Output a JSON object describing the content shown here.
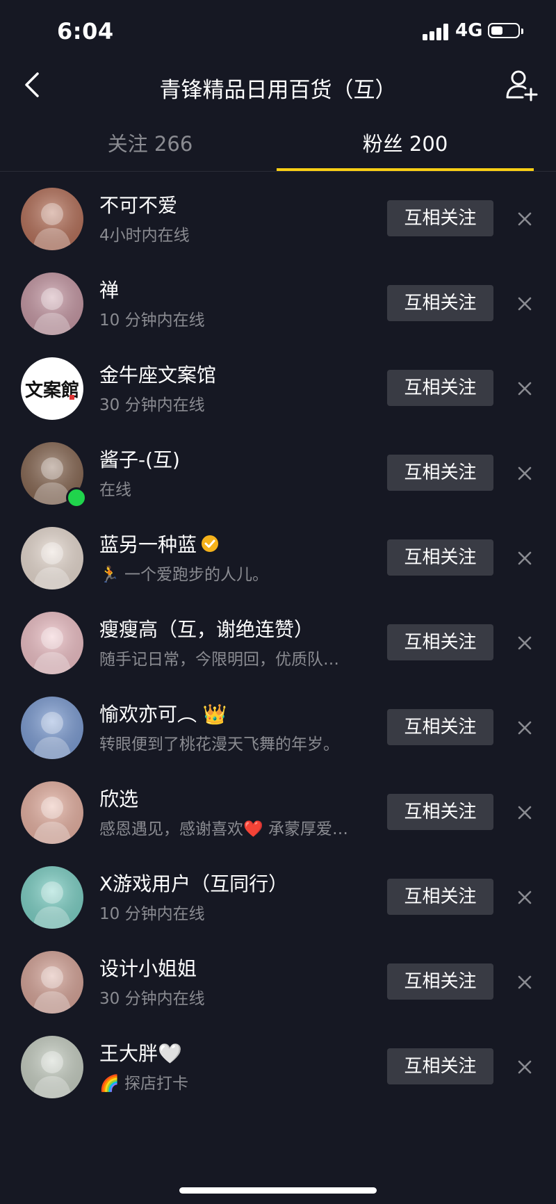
{
  "status_bar": {
    "time": "6:04",
    "network": "4G",
    "battery_level": 0.45
  },
  "header": {
    "title": "青锋精品日用百货（互）"
  },
  "tabs": [
    {
      "label": "关注 266",
      "active": false
    },
    {
      "label": "粉丝 200",
      "active": true
    }
  ],
  "accent_color": "#face15",
  "followers": [
    {
      "name": "不可不爱",
      "subtitle": "4小时内在线",
      "button": "互相关注",
      "avatar_color": "#b8735c"
    },
    {
      "name": "禅",
      "subtitle": "10 分钟内在线",
      "button": "互相关注",
      "avatar_color": "#c89aa6"
    },
    {
      "name": "金牛座文案馆",
      "subtitle": "30 分钟内在线",
      "button": "互相关注",
      "avatar_text": "文案館",
      "avatar_color": "#ffffff"
    },
    {
      "name": "酱子-(互)",
      "subtitle": "在线",
      "button": "互相关注",
      "online": true,
      "avatar_color": "#8a6a55"
    },
    {
      "name": "蓝另一种蓝",
      "subtitle": "🏃 一个爱跑步的人儿。",
      "button": "互相关注",
      "verified": true,
      "avatar_color": "#e9dcd2"
    },
    {
      "name": "瘦瘦高（互，谢绝连赞）",
      "subtitle": "随手记日常，今限明回，优质队…",
      "button": "互相关注",
      "avatar_color": "#f0c2c8"
    },
    {
      "name": "愉欢亦可︵ 👑",
      "subtitle": "转眼便到了桃花漫天飞舞的年岁。",
      "button": "互相关注",
      "avatar_color": "#7f9fd6"
    },
    {
      "name": "欣选",
      "subtitle": "感恩遇见，感谢喜欢❤️ 承蒙厚爱…",
      "button": "互相关注",
      "avatar_color": "#e8b3a4"
    },
    {
      "name": "X游戏用户（互同行）",
      "subtitle": "10 分钟内在线",
      "button": "互相关注",
      "avatar_color": "#7fd3c8"
    },
    {
      "name": "设计小姐姐",
      "subtitle": "30 分钟内在线",
      "button": "互相关注",
      "avatar_color": "#d8a69a"
    },
    {
      "name": "王大胖🤍",
      "subtitle": "🌈 探店打卡",
      "button": "互相关注",
      "avatar_color": "#c9d1c5"
    }
  ]
}
